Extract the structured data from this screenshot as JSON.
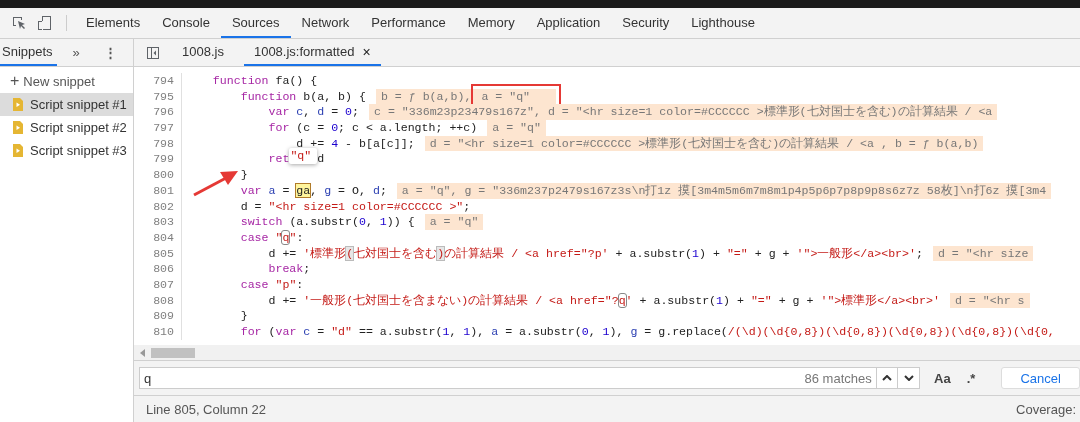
{
  "toolbar": {
    "tabs": [
      {
        "label": "Elements",
        "selected": false
      },
      {
        "label": "Console",
        "selected": false
      },
      {
        "label": "Sources",
        "selected": true
      },
      {
        "label": "Network",
        "selected": false
      },
      {
        "label": "Performance",
        "selected": false
      },
      {
        "label": "Memory",
        "selected": false
      },
      {
        "label": "Application",
        "selected": false
      },
      {
        "label": "Security",
        "selected": false
      },
      {
        "label": "Lighthouse",
        "selected": false
      }
    ]
  },
  "navigator": {
    "tab": {
      "label": "Snippets",
      "selected": true
    },
    "more": "»",
    "menu": "⋮",
    "new_snippet": {
      "icon": "+",
      "label": "New snippet"
    },
    "items": [
      {
        "label": "Script snippet #1",
        "selected": true
      },
      {
        "label": "Script snippet #2",
        "selected": false
      },
      {
        "label": "Script snippet #3",
        "selected": false
      }
    ]
  },
  "editor_tabs": [
    {
      "label": "1008.js",
      "selected": false
    },
    {
      "label": "1008.js:formatted",
      "selected": true,
      "close": "×"
    }
  ],
  "code": {
    "lines": [
      {
        "number": "794",
        "tokens": [
          {
            "t": "    function",
            "kind": "kw"
          },
          {
            "t": " fa() {",
            "kind": "plain"
          }
        ]
      },
      {
        "number": "795",
        "tokens": [
          {
            "t": "        function",
            "kind": "kw"
          },
          {
            "t": " b(a, b) {",
            "kind": "plain"
          }
        ],
        "annotation": [
          {
            "text": "b = ƒ b(a,b),",
            "marked": false
          },
          {
            "text": "a = \"q\"",
            "marked": true
          }
        ]
      },
      {
        "number": "796",
        "tokens": [
          {
            "t": "            var",
            "kind": "kw"
          },
          {
            "t": " c",
            "kind": "def"
          },
          {
            "t": ", ",
            "kind": "plain"
          },
          {
            "t": "d",
            "kind": "def"
          },
          {
            "t": " = ",
            "kind": "plain"
          },
          {
            "t": "0",
            "kind": "num"
          },
          {
            "t": ";",
            "kind": "plain"
          }
        ],
        "annotation": [
          {
            "text": "c = \"336m23p23479s167z\", d = \"<hr size=1 color=#CCCCCC >標準形(七対国士を含む)の計算結果 / <a",
            "marked": false
          }
        ]
      },
      {
        "number": "797",
        "tokens": [
          {
            "t": "            for",
            "kind": "kw"
          },
          {
            "t": " (c = ",
            "kind": "plain"
          },
          {
            "t": "0",
            "kind": "num"
          },
          {
            "t": "; c < a.length; ++c)",
            "kind": "plain"
          }
        ],
        "annotation": [
          {
            "text": "a = \"q\"",
            "marked": false
          }
        ]
      },
      {
        "number": "798",
        "tokens": [
          {
            "t": "                d += ",
            "kind": "plain"
          },
          {
            "t": "4",
            "kind": "num"
          },
          {
            "t": " - b[a[c]];",
            "kind": "plain"
          }
        ],
        "annotation": [
          {
            "text": "d = \"<hr size=1 color=#CCCCCC >標準形(七対国士を含む)の計算結果 / <a , b = ƒ b(a,b)",
            "marked": false
          }
        ]
      },
      {
        "number": "799",
        "tokens": [
          {
            "t": "            ret",
            "kind": "kw"
          }
        ],
        "popup": "\"q\"",
        "tail": [
          {
            "t": "d",
            "kind": "plain"
          }
        ]
      },
      {
        "number": "800",
        "tokens": [
          {
            "t": "        }",
            "kind": "plain"
          }
        ]
      },
      {
        "number": "801",
        "tokens": [
          {
            "t": "        var",
            "kind": "kw"
          },
          {
            "t": " a",
            "kind": "def"
          },
          {
            "t": " = ",
            "kind": "plain"
          },
          {
            "t": "ga",
            "kind": "current"
          },
          {
            "t": ", ",
            "kind": "plain"
          },
          {
            "t": "g",
            "kind": "def"
          },
          {
            "t": " = O, ",
            "kind": "plain"
          },
          {
            "t": "d",
            "kind": "def"
          },
          {
            "t": ";",
            "kind": "plain"
          }
        ],
        "annotation": [
          {
            "text": "a = \"q\", g = \"336m237p2479s167z3s\\n打1z 摸[3m4m5m6m7m8m1p4p5p6p7p8p9p8s6z7z 58枚]\\n打6z 摸[3m4",
            "marked": false
          }
        ]
      },
      {
        "number": "802",
        "tokens": [
          {
            "t": "        d = ",
            "kind": "plain"
          },
          {
            "t": "\"<hr size=1 color=#CCCCCC >\"",
            "kind": "str"
          },
          {
            "t": ";",
            "kind": "plain"
          }
        ]
      },
      {
        "number": "803",
        "tokens": [
          {
            "t": "        switch",
            "kind": "kw"
          },
          {
            "t": " (a.substr(",
            "kind": "plain"
          },
          {
            "t": "0",
            "kind": "num"
          },
          {
            "t": ", ",
            "kind": "plain"
          },
          {
            "t": "1",
            "kind": "num"
          },
          {
            "t": ")) {",
            "kind": "plain"
          }
        ],
        "annotation": [
          {
            "text": "a = \"q\"",
            "marked": false
          }
        ]
      },
      {
        "number": "804",
        "tokens": [
          {
            "t": "        case",
            "kind": "kw"
          },
          {
            "t": " \"",
            "kind": "str"
          },
          {
            "t": "q",
            "kind": "match"
          },
          {
            "t": "\"",
            "kind": "str"
          },
          {
            "t": ":",
            "kind": "plain"
          }
        ]
      },
      {
        "number": "805",
        "tokens": [
          {
            "t": "            d += ",
            "kind": "plain"
          },
          {
            "t": "'標準形",
            "kind": "str"
          },
          {
            "t": "(",
            "kind": "bracket"
          },
          {
            "t": "七対国士を含む",
            "kind": "str"
          },
          {
            "t": ")",
            "kind": "bracket"
          },
          {
            "t": "の計算結果 / <a href=\"?p'",
            "kind": "str"
          },
          {
            "t": " + a.substr(",
            "kind": "plain"
          },
          {
            "t": "1",
            "kind": "num"
          },
          {
            "t": ") + ",
            "kind": "plain"
          },
          {
            "t": "\"=\"",
            "kind": "str"
          },
          {
            "t": " + g + ",
            "kind": "plain"
          },
          {
            "t": "'\">一般形</a><br>'",
            "kind": "str"
          },
          {
            "t": ";",
            "kind": "plain"
          }
        ],
        "annotation": [
          {
            "text": "d = \"<hr size",
            "marked": false
          }
        ]
      },
      {
        "number": "806",
        "tokens": [
          {
            "t": "            break",
            "kind": "kw"
          },
          {
            "t": ";",
            "kind": "plain"
          }
        ]
      },
      {
        "number": "807",
        "tokens": [
          {
            "t": "        case",
            "kind": "kw"
          },
          {
            "t": " \"p\"",
            "kind": "str"
          },
          {
            "t": ":",
            "kind": "plain"
          }
        ]
      },
      {
        "number": "808",
        "tokens": [
          {
            "t": "            d += ",
            "kind": "plain"
          },
          {
            "t": "'一般形(七対国士を含まない)の計算結果 / <a href=\"?",
            "kind": "str"
          },
          {
            "t": "q",
            "kind": "match"
          },
          {
            "t": "'",
            "kind": "str"
          },
          {
            "t": " + a.substr(",
            "kind": "plain"
          },
          {
            "t": "1",
            "kind": "num"
          },
          {
            "t": ") + ",
            "kind": "plain"
          },
          {
            "t": "\"=\"",
            "kind": "str"
          },
          {
            "t": " + g + ",
            "kind": "plain"
          },
          {
            "t": "'\">標準形</a><br>'",
            "kind": "str"
          }
        ],
        "annotation": [
          {
            "text": "d = \"<hr s",
            "marked": false
          }
        ]
      },
      {
        "number": "809",
        "tokens": [
          {
            "t": "        }",
            "kind": "plain"
          }
        ]
      },
      {
        "number": "810",
        "tokens": [
          {
            "t": "        for",
            "kind": "kw"
          },
          {
            "t": " (",
            "kind": "plain"
          },
          {
            "t": "var",
            "kind": "kw"
          },
          {
            "t": " c",
            "kind": "def"
          },
          {
            "t": " = ",
            "kind": "plain"
          },
          {
            "t": "\"d\"",
            "kind": "str"
          },
          {
            "t": " == a.substr(",
            "kind": "plain"
          },
          {
            "t": "1",
            "kind": "num"
          },
          {
            "t": ", ",
            "kind": "plain"
          },
          {
            "t": "1",
            "kind": "num"
          },
          {
            "t": "), ",
            "kind": "plain"
          },
          {
            "t": "a",
            "kind": "def"
          },
          {
            "t": " = a.substr(",
            "kind": "plain"
          },
          {
            "t": "0",
            "kind": "num"
          },
          {
            "t": ", ",
            "kind": "plain"
          },
          {
            "t": "1",
            "kind": "num"
          },
          {
            "t": "), ",
            "kind": "plain"
          },
          {
            "t": "g",
            "kind": "def"
          },
          {
            "t": " = g.replace(",
            "kind": "plain"
          },
          {
            "t": "/(\\d)(\\d{0,8})(\\d{0,8})(\\d{0,8})(\\d{0,8})(\\d{0,",
            "kind": "str"
          }
        ]
      }
    ]
  },
  "search": {
    "value": "q",
    "matches": "86 matches",
    "case_toggle": "Aa",
    "regex_toggle": ".*",
    "cancel": "Cancel"
  },
  "status": {
    "position": "Line 805, Column 22",
    "coverage": "Coverage:"
  }
}
